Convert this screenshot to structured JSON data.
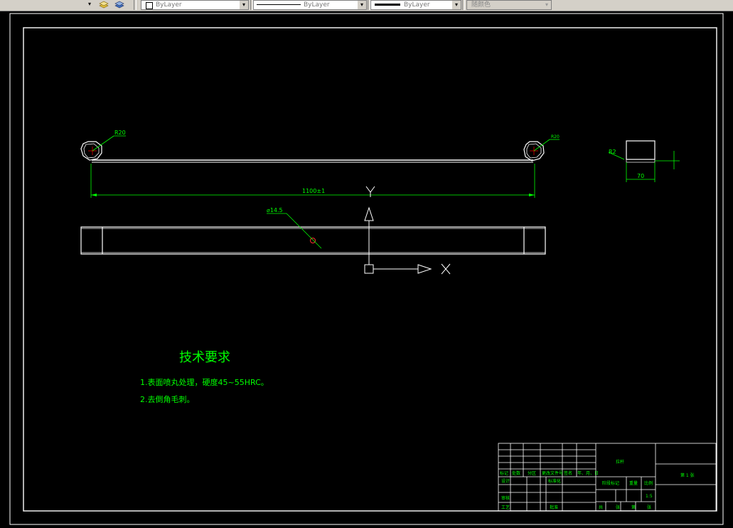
{
  "toolbar": {
    "layer_dropdown_arrow": "▾",
    "color": {
      "value": "ByLayer"
    },
    "linetype": {
      "value": "ByLayer"
    },
    "lineweight": {
      "value": "ByLayer"
    },
    "plotstyle": {
      "value": "随颜色"
    }
  },
  "drawing": {
    "dim_r20": "R20",
    "dim_r20_right": "R20",
    "dim_length": "1100±1",
    "dim_hole": "⌀14.5",
    "dim_70": "70",
    "dim_r2": "R2",
    "ucs_y": "Y",
    "ucs_x": "X",
    "tech_title": "技术要求",
    "tech_items": [
      "1.表面喷丸处理，硬度45~55HRC。",
      "2.去倒角毛刺。"
    ]
  },
  "title_block": {
    "part_name": "拉杆",
    "sheet_info": "第 1 张",
    "row_labels": [
      "标记",
      "处数",
      "分区",
      "更改文件号",
      "签名",
      "年、月、日"
    ],
    "designer": "设计",
    "standardize": "标准化",
    "checker": "审核",
    "process": "工艺",
    "approve": "批准",
    "stage_mark": "阶段标记",
    "weight": "重量",
    "scale": "比例",
    "scale_value": "1:5",
    "bottom_row": [
      "共",
      "张",
      "第",
      "张"
    ]
  },
  "colors": {
    "background": "#000000",
    "geometry": "#ffffff",
    "dimension": "#00ff00",
    "center": "#ff0000",
    "toolbar": "#d4d0c8"
  }
}
